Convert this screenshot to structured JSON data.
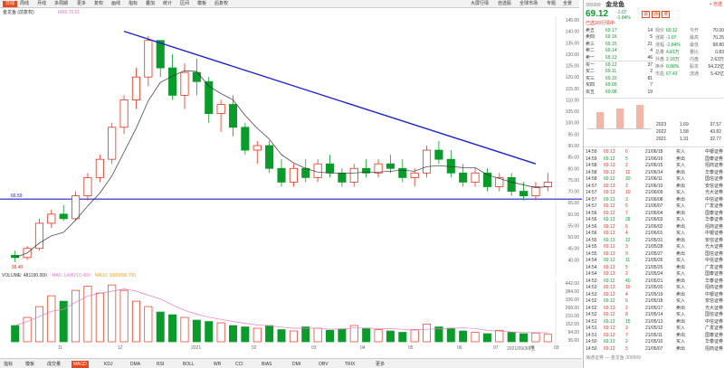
{
  "colors": {
    "up": "#e8301b",
    "down": "#0a9b2b",
    "trendline": "#1e20c8",
    "support": "#1e20c8",
    "ma": "#333333",
    "vol_ma": "#e879c8",
    "accent": "#e8481b"
  },
  "toolbar": {
    "items": [
      "日线",
      "周线",
      "月线",
      "多周期",
      "更多",
      "复权",
      "画线",
      "指标",
      "叠加",
      "统计",
      "区间",
      "模板",
      "后复权"
    ],
    "active": "日线",
    "right_items": [
      "大屏行情",
      "自选股",
      "全球市场",
      "专题",
      "全景"
    ]
  },
  "infobar": {
    "text": "金龙鱼 (前复权)",
    "ma_label": "MA5:70.61"
  },
  "price_axis": [
    "145.00",
    "140.00",
    "135.00",
    "130.00",
    "125.00",
    "120.00",
    "115.00",
    "110.00",
    "105.00",
    "100.00",
    "95.00",
    "90.00",
    "85.00",
    "80.00",
    "75.00",
    "70.00",
    "65.00",
    "60.00",
    "55.00",
    "50.00",
    "45.00",
    "40.00"
  ],
  "support_label": "66.59",
  "low_label": "38.40",
  "vol": {
    "title": "VOLUME: 481190.000",
    "ma5": "MA5: 1408710.400",
    "ma10": "MA10: 1005006.700"
  },
  "vol_axis": [
    "442.00",
    "384.00",
    "326.00",
    "268.00",
    "210.00",
    "152.00",
    "94.00",
    "36.00"
  ],
  "x_axis": [
    "11",
    "12",
    "2021",
    "02",
    "03",
    "04",
    "05",
    "06",
    "07",
    "08",
    "09",
    "2021/09/30/五"
  ],
  "bottom_tabs": [
    "指标",
    "模板",
    "成交量",
    "MACD",
    "KDJ",
    "DMA",
    "RSI",
    "BOLL",
    "WR",
    "CCI",
    "BIAS",
    "DMI",
    "OBV",
    "TRIX",
    "更多"
  ],
  "bottom_active": "MACD",
  "chart_data": {
    "type": "candlestick",
    "ylim": [
      35,
      145
    ],
    "candles": [
      [
        42,
        44,
        39,
        41
      ],
      [
        41,
        46,
        40,
        45
      ],
      [
        45,
        58,
        44,
        56
      ],
      [
        56,
        62,
        54,
        60
      ],
      [
        60,
        64,
        57,
        58
      ],
      [
        58,
        70,
        57,
        68
      ],
      [
        68,
        78,
        66,
        76
      ],
      [
        76,
        86,
        74,
        84
      ],
      [
        84,
        100,
        82,
        98
      ],
      [
        98,
        112,
        95,
        110
      ],
      [
        110,
        124,
        106,
        120
      ],
      [
        120,
        138,
        116,
        136
      ],
      [
        136,
        132,
        120,
        124
      ],
      [
        124,
        130,
        110,
        112
      ],
      [
        112,
        126,
        106,
        122
      ],
      [
        122,
        128,
        112,
        118
      ],
      [
        118,
        120,
        100,
        104
      ],
      [
        104,
        110,
        96,
        108
      ],
      [
        108,
        112,
        94,
        98
      ],
      [
        98,
        100,
        86,
        88
      ],
      [
        88,
        92,
        82,
        90
      ],
      [
        90,
        92,
        78,
        80
      ],
      [
        80,
        84,
        72,
        74
      ],
      [
        74,
        82,
        72,
        80
      ],
      [
        80,
        84,
        74,
        76
      ],
      [
        76,
        84,
        74,
        82
      ],
      [
        82,
        86,
        76,
        78
      ],
      [
        78,
        80,
        72,
        74
      ],
      [
        74,
        82,
        72,
        80
      ],
      [
        80,
        84,
        76,
        78
      ],
      [
        78,
        84,
        76,
        82
      ],
      [
        82,
        86,
        78,
        80
      ],
      [
        80,
        84,
        74,
        76
      ],
      [
        76,
        80,
        72,
        78
      ],
      [
        78,
        90,
        76,
        88
      ],
      [
        88,
        92,
        82,
        84
      ],
      [
        84,
        88,
        76,
        78
      ],
      [
        78,
        82,
        72,
        74
      ],
      [
        74,
        80,
        72,
        78
      ],
      [
        78,
        80,
        70,
        72
      ],
      [
        72,
        78,
        70,
        76
      ],
      [
        76,
        78,
        68,
        70
      ],
      [
        70,
        74,
        66,
        68
      ],
      [
        68,
        74,
        66,
        72
      ],
      [
        72,
        78,
        70,
        74
      ]
    ],
    "trend_line": {
      "from": [
        9,
        140
      ],
      "to": [
        43,
        82
      ]
    },
    "support_line": 66.59,
    "volume": [
      120,
      180,
      260,
      340,
      300,
      380,
      410,
      360,
      420,
      380,
      300,
      260,
      220,
      200,
      180,
      160,
      150,
      140,
      120,
      110,
      100,
      120,
      90,
      80,
      110,
      100,
      85,
      95,
      120,
      100,
      90,
      80,
      70,
      90,
      130,
      110,
      100,
      80,
      70,
      60,
      85,
      70,
      60,
      65,
      55
    ]
  },
  "right_panel": {
    "code": "300999",
    "name": "金龙鱼",
    "price": "69.12",
    "change": "-1.07",
    "change_pct": "-1.84%",
    "tags": [
      "融",
      "通",
      "港"
    ],
    "subtitle": "已选2/3行情中",
    "order_book": [
      [
        "卖五",
        "69.17",
        "14"
      ],
      [
        "卖四",
        "69.16",
        "5"
      ],
      [
        "卖三",
        "69.15",
        "21"
      ],
      [
        "卖二",
        "69.14",
        "4"
      ],
      [
        "卖一",
        "69.13",
        "46"
      ],
      [
        "买一",
        "69.12",
        "37"
      ],
      [
        "买二",
        "69.11",
        "2"
      ],
      [
        "买三",
        "69.10",
        "81"
      ],
      [
        "买四",
        "69.09",
        "7"
      ],
      [
        "买五",
        "69.08",
        "19"
      ]
    ],
    "stats": [
      [
        "现价",
        "69.12",
        "今开",
        "70.00"
      ],
      [
        "涨跌",
        "-1.07",
        "最高",
        "70.25"
      ],
      [
        "涨幅",
        "-1.84%",
        "最低",
        "68.80"
      ],
      [
        "总量",
        "4.81万",
        "量比",
        "0.83"
      ],
      [
        "外盘",
        "2.18万",
        "内盘",
        "2.63万"
      ],
      [
        "换手",
        "0.88%",
        "股本",
        "54.22亿"
      ],
      [
        "市盈",
        "67.43",
        "流通",
        "5.42亿"
      ]
    ],
    "fundamentals": [
      [
        "2023",
        "1.69",
        "37.57"
      ],
      [
        "2022",
        "1.58",
        "43.82"
      ],
      [
        "2021",
        "1.31",
        "32.77"
      ]
    ],
    "trades": [
      [
        "14:59",
        "69.13",
        "6"
      ],
      [
        "14:59",
        "69.12",
        "5"
      ],
      [
        "14:58",
        "69.13",
        "2"
      ],
      [
        "14:58",
        "69.12",
        "12"
      ],
      [
        "14:58",
        "69.12",
        "20"
      ],
      [
        "14:57",
        "69.13",
        "2"
      ],
      [
        "14:57",
        "69.12",
        "10"
      ],
      [
        "14:57",
        "69.13",
        "3"
      ],
      [
        "14:57",
        "69.12",
        "5"
      ],
      [
        "14:56",
        "69.12",
        "7"
      ],
      [
        "14:56",
        "69.13",
        "28"
      ],
      [
        "14:56",
        "69.12",
        "6"
      ],
      [
        "14:56",
        "69.12",
        "4"
      ],
      [
        "14:55",
        "69.13",
        "12"
      ],
      [
        "14:55",
        "69.12",
        "3"
      ],
      [
        "14:55",
        "69.13",
        "9"
      ],
      [
        "14:54",
        "69.12",
        "11"
      ],
      [
        "14:54",
        "69.12",
        "5"
      ],
      [
        "14:54",
        "69.13",
        "2"
      ],
      [
        "14:53",
        "69.12",
        "40"
      ],
      [
        "14:53",
        "69.13",
        "19"
      ],
      [
        "14:53",
        "69.12",
        "4"
      ],
      [
        "14:52",
        "69.12",
        "6"
      ],
      [
        "14:52",
        "69.13",
        "2"
      ],
      [
        "14:52",
        "69.12",
        "8"
      ],
      [
        "14:51",
        "69.13",
        "15"
      ],
      [
        "14:51",
        "69.12",
        "3"
      ],
      [
        "14:51",
        "69.12",
        "7"
      ],
      [
        "14:50",
        "69.13",
        "2"
      ],
      [
        "14:50",
        "69.12",
        "5"
      ]
    ],
    "deals": [
      [
        "21/06/18",
        "买入",
        "中银证券"
      ],
      [
        "21/06/16",
        "卖出",
        "国泰证券"
      ],
      [
        "21/06/15",
        "买入",
        "招商证券"
      ],
      [
        "21/06/14",
        "卖出",
        "华泰证券"
      ],
      [
        "21/06/11",
        "买入",
        "国信证券"
      ],
      [
        "21/06/10",
        "卖出",
        "安信证券"
      ],
      [
        "21/06/09",
        "买入",
        "光大证券"
      ],
      [
        "21/06/08",
        "卖出",
        "中信证券"
      ],
      [
        "21/06/07",
        "买入",
        "广发证券"
      ],
      [
        "21/06/04",
        "卖出",
        "国泰证券"
      ],
      [
        "21/06/03",
        "买入",
        "华泰证券"
      ],
      [
        "21/06/02",
        "卖出",
        "招商证券"
      ],
      [
        "21/06/01",
        "买入",
        "中银证券"
      ],
      [
        "21/05/31",
        "卖出",
        "安信证券"
      ],
      [
        "21/05/28",
        "买入",
        "光大证券"
      ],
      [
        "21/05/27",
        "卖出",
        "国信证券"
      ],
      [
        "21/05/26",
        "买入",
        "中信证券"
      ],
      [
        "21/05/25",
        "卖出",
        "广发证券"
      ],
      [
        "21/05/24",
        "买入",
        "国泰证券"
      ],
      [
        "21/05/21",
        "卖出",
        "华泰证券"
      ],
      [
        "21/05/20",
        "买入",
        "招商证券"
      ],
      [
        "21/05/19",
        "卖出",
        "中银证券"
      ],
      [
        "21/05/18",
        "买入",
        "安信证券"
      ],
      [
        "21/05/17",
        "卖出",
        "光大证券"
      ],
      [
        "21/05/14",
        "买入",
        "国信证券"
      ],
      [
        "21/05/13",
        "卖出",
        "中信证券"
      ],
      [
        "21/05/12",
        "买入",
        "广发证券"
      ],
      [
        "21/05/11",
        "卖出",
        "国泰证券"
      ],
      [
        "21/05/10",
        "买入",
        "华泰证券"
      ],
      [
        "21/05/07",
        "卖出",
        "招商证券"
      ]
    ],
    "footer": "海通证券 — 金龙鱼 300999"
  }
}
